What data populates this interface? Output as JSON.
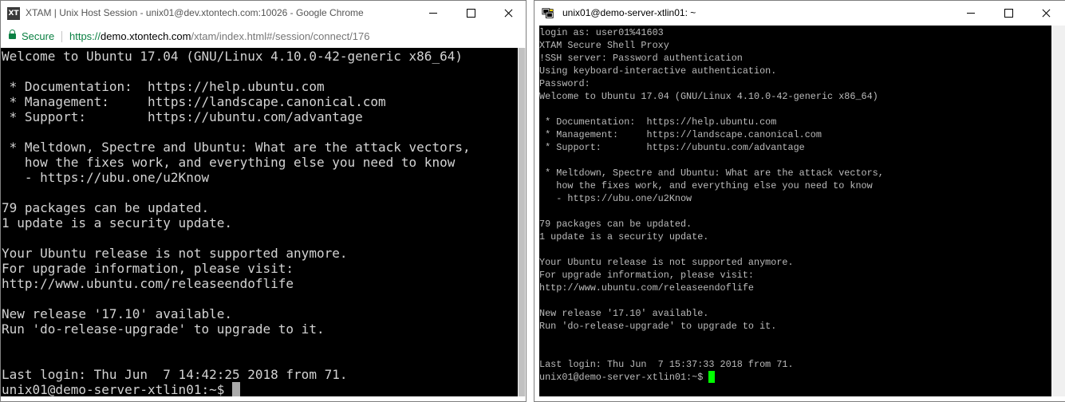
{
  "browser_window": {
    "app_logo": "XT",
    "title": "XTAM | Unix Host Session - unix01@dev.xtontech.com:10026 - Google Chrome",
    "secure_label": "Secure",
    "url_scheme": "https://",
    "url_host": "demo.xtontech.com",
    "url_path": "/xtam/index.html#/session/connect/176",
    "terminal_text": "Welcome to Ubuntu 17.04 (GNU/Linux 4.10.0-42-generic x86_64)\n\n * Documentation:  https://help.ubuntu.com\n * Management:     https://landscape.canonical.com\n * Support:        https://ubuntu.com/advantage\n\n * Meltdown, Spectre and Ubuntu: What are the attack vectors,\n   how the fixes work, and everything else you need to know\n   - https://ubu.one/u2Know\n\n79 packages can be updated.\n1 update is a security update.\n\nYour Ubuntu release is not supported anymore.\nFor upgrade information, please visit:\nhttp://www.ubuntu.com/releaseendoflife\n\nNew release '17.10' available.\nRun 'do-release-upgrade' to upgrade to it.\n\n\nLast login: Thu Jun  7 14:42:25 2018 from 71.",
    "prompt": "unix01@demo-server-xtlin01:~$ "
  },
  "putty_window": {
    "title": "unix01@demo-server-xtlin01: ~",
    "terminal_text": "login as: user01%41603\nXTAM Secure Shell Proxy\n!SSH server: Password authentication\nUsing keyboard-interactive authentication.\nPassword:\nWelcome to Ubuntu 17.04 (GNU/Linux 4.10.0-42-generic x86_64)\n\n * Documentation:  https://help.ubuntu.com\n * Management:     https://landscape.canonical.com\n * Support:        https://ubuntu.com/advantage\n\n * Meltdown, Spectre and Ubuntu: What are the attack vectors,\n   how the fixes work, and everything else you need to know\n   - https://ubu.one/u2Know\n\n79 packages can be updated.\n1 update is a security update.\n\nYour Ubuntu release is not supported anymore.\nFor upgrade information, please visit:\nhttp://www.ubuntu.com/releaseendoflife\n\nNew release '17.10' available.\nRun 'do-release-upgrade' to upgrade to it.\n\n\nLast login: Thu Jun  7 15:37:33 2018 from 71.",
    "prompt": "unix01@demo-server-xtlin01:~$ "
  },
  "icons": {
    "browser_app": "xtam-logo-icon",
    "putty_app": "putty-icon",
    "lock": "lock-icon",
    "minimize": "minimize-icon",
    "maximize": "maximize-icon",
    "close": "close-icon"
  },
  "colors": {
    "secure_green": "#0b8043",
    "browser_terminal_text": "#d3d3d3",
    "putty_terminal_text": "#bbbbbb",
    "putty_cursor": "#00ff00",
    "terminal_background": "#000000"
  }
}
